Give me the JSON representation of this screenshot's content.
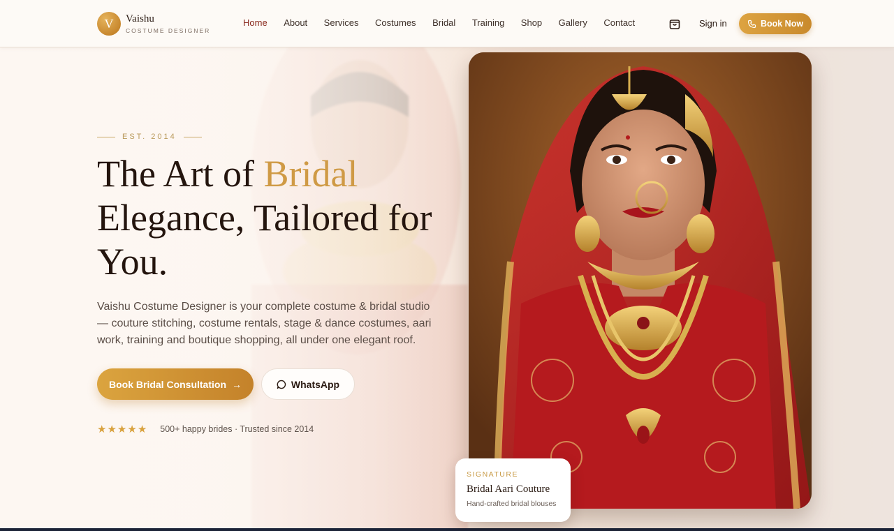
{
  "brand": {
    "initial": "V",
    "name": "Vaishu",
    "tagline": "COSTUME DESIGNER"
  },
  "nav": {
    "items": [
      {
        "label": "Home",
        "active": true
      },
      {
        "label": "About"
      },
      {
        "label": "Services"
      },
      {
        "label": "Costumes"
      },
      {
        "label": "Bridal"
      },
      {
        "label": "Training"
      },
      {
        "label": "Shop"
      },
      {
        "label": "Gallery"
      },
      {
        "label": "Contact"
      }
    ],
    "cart_icon": "shopping-bag-icon",
    "signin_label": "Sign in",
    "book_label": "Book Now",
    "book_icon": "phone-icon"
  },
  "hero": {
    "est": "EST. 2014",
    "headline_pre": "The Art of ",
    "headline_accent": "Bridal",
    "headline_post": "Elegance, Tailored for You.",
    "lead": "Vaishu Costume Designer is your complete costume & bridal studio — couture stitching, costume rentals, stage & dance costumes, aari work, training and boutique shopping, all under one elegant roof.",
    "cta_primary": "Book Bridal Consultation",
    "cta_primary_icon": "arrow-right-icon",
    "cta_secondary": "WhatsApp",
    "cta_secondary_icon": "chat-bubble-icon",
    "stars": 5,
    "rating_text": "500+ happy brides · Trusted since 2014"
  },
  "feature_card": {
    "kicker": "SIGNATURE",
    "title": "Bridal Aari Couture",
    "subtitle": "Hand-crafted bridal blouses"
  },
  "colors": {
    "accent": "#d19a3f",
    "accent_dark": "#c4822a",
    "active_nav": "#8a2a1e",
    "text_dark": "#24150e",
    "bridal_red": "#b51a1e"
  }
}
